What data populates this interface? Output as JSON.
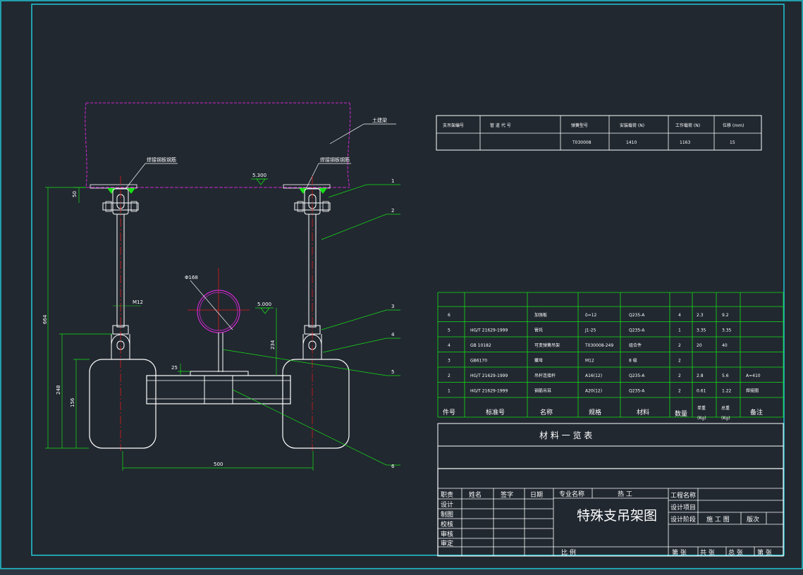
{
  "colors": {
    "background": "#212830",
    "frame": "#22c8d6",
    "line": "#ffffff",
    "table": "#16e016",
    "magenta": "#d028d0",
    "red": "#e01818",
    "dim": "#16e016"
  },
  "drawing": {
    "pipe_label": "土建梁",
    "left_plate_label": "焊接钢板钢筋",
    "right_plate_label": "焊接钢板钢筋",
    "elev_top": "5.300",
    "elev_pipe": "5.000",
    "pipe_dia": "Φ168",
    "rod_size": "M12",
    "dims": {
      "d50": "50",
      "d664": "664",
      "d248": "248",
      "d156": "156",
      "d234": "234",
      "d25": "25",
      "d500": "500"
    },
    "callouts": [
      "1",
      "2",
      "3",
      "4",
      "5",
      "6"
    ]
  },
  "top_table": {
    "headers": [
      "支吊架编号",
      "管 道 代 号",
      "弹簧型号",
      "安装载荷 (N)",
      "工作载荷 (N)",
      "位移 (mm)"
    ],
    "row": [
      "",
      "",
      "T030008",
      "1410",
      "1163",
      "15"
    ]
  },
  "bom": {
    "rows": [
      {
        "no": "6",
        "std": "",
        "name": "加强板",
        "spec": "δ=12",
        "mat": "Q235-A",
        "qty": "4",
        "unit": "2.3",
        "total": "9.2",
        "remark": ""
      },
      {
        "no": "5",
        "std": "HG/T 21629-1999",
        "name": "管托",
        "spec": "J1-25",
        "mat": "Q235-A",
        "qty": "1",
        "unit": "3.35",
        "total": "3.35",
        "remark": ""
      },
      {
        "no": "4",
        "std": "GB 10182",
        "name": "可变弹簧吊架",
        "spec": "T030008-249",
        "mat": "组合件",
        "qty": "2",
        "unit": "20",
        "total": "40",
        "remark": ""
      },
      {
        "no": "3",
        "std": "GB6170",
        "name": "螺母",
        "spec": "M12",
        "mat": "8 级",
        "qty": "2",
        "unit": "",
        "total": "",
        "remark": ""
      },
      {
        "no": "2",
        "std": "HG/T 21629-1999",
        "name": "吊杆连接杆",
        "spec": "A16(12)",
        "mat": "Q235-A",
        "qty": "2",
        "unit": "2.8",
        "total": "5.6",
        "remark": "A=410"
      },
      {
        "no": "1",
        "std": "HG/T 21629-1999",
        "name": "钢筋吊耳",
        "spec": "A20(12)",
        "mat": "Q235-A",
        "qty": "2",
        "unit": "0.61",
        "total": "1.22",
        "remark": "焊接圈"
      }
    ],
    "header": {
      "no": "件号",
      "std": "标准号",
      "name": "名称",
      "spec": "规格",
      "mat": "材料",
      "qty": "数量",
      "unit": "单重",
      "unit2": "(Kg)",
      "total": "总重",
      "total2": "(Kg)",
      "remark": "备注"
    },
    "title": "材 料 一 览 表"
  },
  "title_block": {
    "title": "特殊支吊架图",
    "row_head": [
      "职责",
      "姓名",
      "签字",
      "日期"
    ],
    "roles": [
      "设计",
      "制图",
      "校核",
      "审核",
      "审定"
    ],
    "specialty_label": "专业名称",
    "specialty_value": "热 工",
    "project_name": "工程名称",
    "design_item": "设计项目",
    "design_stage": "设计阶段",
    "stage_value": "施 工 图",
    "version": "版次",
    "scale": "比 例",
    "sheets": [
      "第 张",
      "共 张",
      "总 张",
      "第 张"
    ]
  }
}
